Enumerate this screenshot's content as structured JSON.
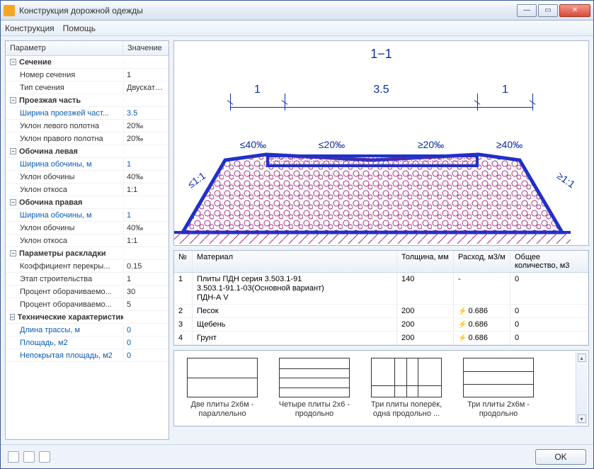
{
  "window": {
    "title": "Конструкция дорожной одежды"
  },
  "menu": {
    "item0": "Конструкция",
    "item1": "Помощь"
  },
  "grid": {
    "header_param": "Параметр",
    "header_value": "Значение",
    "groups": {
      "g0": "Сечение",
      "g1": "Проезжая часть",
      "g2": "Обочина левая",
      "g3": "Обочина правая",
      "g4": "Параметры раскладки",
      "g5": "Технические характеристики"
    },
    "rows": {
      "r0_p": "Номер сечения",
      "r0_v": "1",
      "r1_p": "Тип сечения",
      "r1_v": "Двускатна...",
      "r2_p": "Ширина проезжей част...",
      "r2_v": "3.5",
      "r3_p": "Уклон левого полотна",
      "r3_v": "20‰",
      "r4_p": "Уклон правого полотна",
      "r4_v": "20‰",
      "r5_p": "Ширина обочины, м",
      "r5_v": "1",
      "r6_p": "Уклон обочины",
      "r6_v": "40‰",
      "r7_p": "Уклон откоса",
      "r7_v": "1:1",
      "r8_p": "Ширина обочины, м",
      "r8_v": "1",
      "r9_p": "Уклон обочины",
      "r9_v": "40‰",
      "r10_p": "Уклон откоса",
      "r10_v": "1:1",
      "r11_p": "Коэффициент перекры...",
      "r11_v": "0.15",
      "r12_p": "Этап строительства",
      "r12_v": "1",
      "r13_p": "Процент оборачиваемо...",
      "r13_v": "30",
      "r14_p": "Процент оборачиваемо...",
      "r14_v": "5",
      "r15_p": "Длина трассы, м",
      "r15_v": "0",
      "r16_p": "Площадь, м2",
      "r16_v": "0",
      "r17_p": "Непокрытая площадь, м2",
      "r17_v": "0"
    }
  },
  "drawing": {
    "title": "1−1",
    "dim_left": "1",
    "dim_mid": "3.5",
    "dim_right": "1",
    "slope_l_shoulder": "≤40‰",
    "slope_l_lane": "≤20‰",
    "slope_r_lane": "≥20‰",
    "slope_r_shoulder": "≥40‰",
    "side_l": "≤1:1",
    "side_r": "≥1:1"
  },
  "materials": {
    "head_n": "№",
    "head_mat": "Материал",
    "head_th": "Толщина, мм",
    "head_cons": "Расход, м3/м",
    "head_qty": "Общее количество, м3",
    "r1_n": "1",
    "r1_mat_a": "Плиты ПДН серия 3.503.1-91",
    "r1_mat_b": "3.503.1-91.1-03(Основной вариант)",
    "r1_mat_c": "ПДН-А V",
    "r1_th": "140",
    "r1_cons": "-",
    "r1_qty": "0",
    "r2_n": "2",
    "r2_mat": "Песок",
    "r2_th": "200",
    "r2_cons": "0.686",
    "r2_qty": "0",
    "r3_n": "3",
    "r3_mat": "Щебень",
    "r3_th": "200",
    "r3_cons": "0.686",
    "r3_qty": "0",
    "r4_n": "4",
    "r4_mat": "Грунт",
    "r4_th": "200",
    "r4_cons": "0.686",
    "r4_qty": "0"
  },
  "layouts": {
    "l0": "Две плиты 2х6м - параллельно",
    "l1": "Четыре плиты 2х6 - продольно",
    "l2": "Три плиты поперёк, одна продольно ...",
    "l3": "Три плиты 2х6м - продольно"
  },
  "footer": {
    "ok": "OK"
  }
}
